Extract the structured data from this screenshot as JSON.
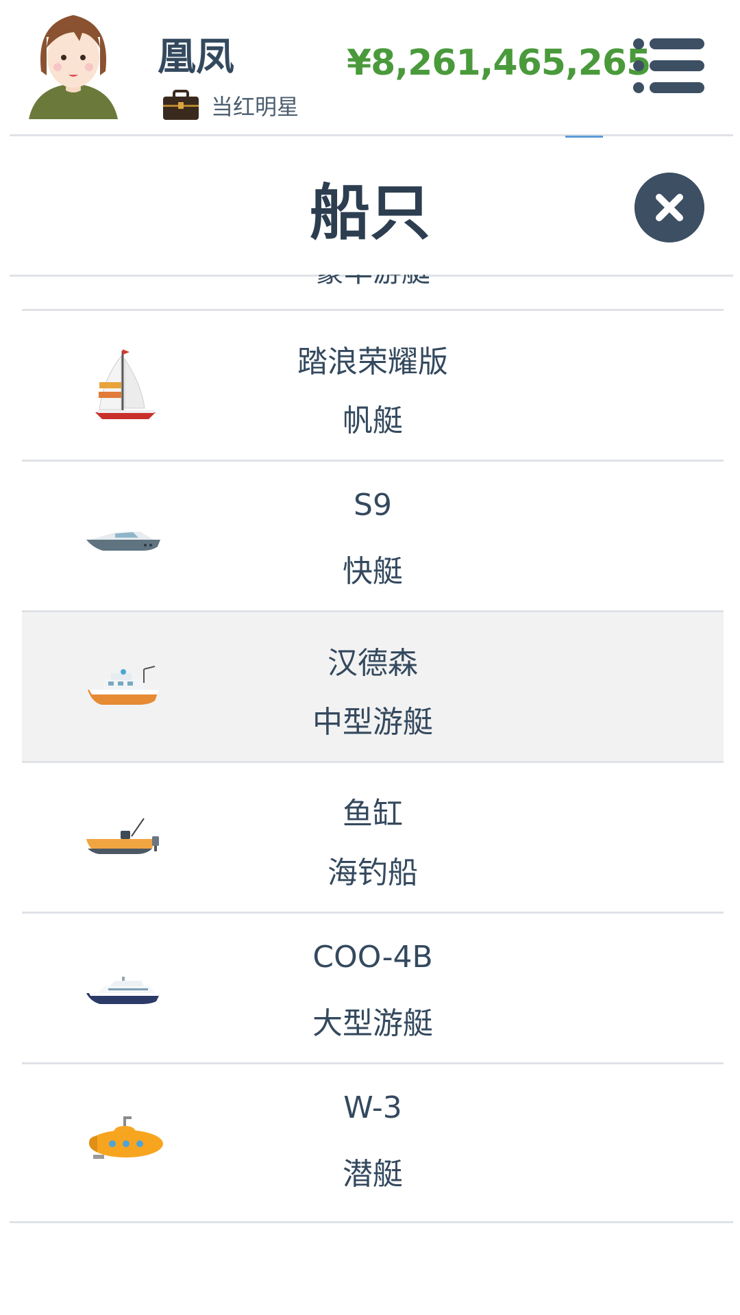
{
  "header": {
    "player_name": "凰凤",
    "job_label": "当红明星",
    "money": "¥8,261,465,265",
    "money_color": "#4a9a3c",
    "avatar_icon": "female-avatar-icon",
    "job_icon": "briefcase-icon",
    "menu_icon": "list-menu-icon"
  },
  "modal": {
    "title": "船只",
    "close_icon": "close-icon"
  },
  "list": {
    "peek_text": "豪华游艇",
    "items": [
      {
        "name": "踏浪荣耀版",
        "type": "帆艇",
        "icon": "sailboat-icon",
        "selected": false
      },
      {
        "name": "S9",
        "type": "快艇",
        "icon": "speedboat-icon",
        "selected": false
      },
      {
        "name": "汉德森",
        "type": "中型游艇",
        "icon": "midsize-yacht-icon",
        "selected": true
      },
      {
        "name": "鱼缸",
        "type": "海钓船",
        "icon": "fishing-boat-icon",
        "selected": false
      },
      {
        "name": "COO-4B",
        "type": "大型游艇",
        "icon": "large-yacht-icon",
        "selected": false
      },
      {
        "name": "W-3",
        "type": "潜艇",
        "icon": "submarine-icon",
        "selected": false
      }
    ]
  }
}
